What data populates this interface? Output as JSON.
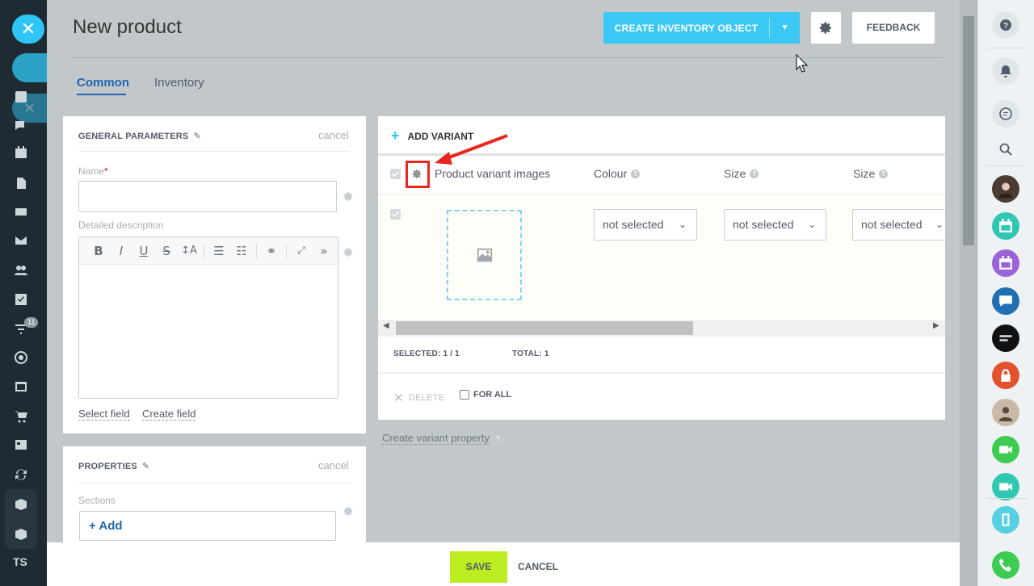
{
  "header": {
    "title": "New product",
    "create_button": "CREATE INVENTORY OBJECT",
    "feedback_button": "FEEDBACK"
  },
  "tabs": [
    {
      "label": "Common",
      "active": true
    },
    {
      "label": "Inventory",
      "active": false
    }
  ],
  "general": {
    "title": "GENERAL PARAMETERS",
    "cancel": "cancel",
    "name_label": "Name",
    "required_mark": "*",
    "name_value": "",
    "description_label": "Detailed description",
    "select_field": "Select field",
    "create_field": "Create field"
  },
  "editor_toolbar": [
    "B",
    "I",
    "U",
    "S",
    "↕A",
    "list-numbered",
    "list-bulleted",
    "link",
    "fullscreen",
    "more"
  ],
  "properties": {
    "title": "PROPERTIES",
    "cancel": "cancel",
    "sections_label": "Sections",
    "add_label": "+ Add"
  },
  "variants": {
    "add_variant": "ADD VARIANT",
    "columns": {
      "images": "Product variant images",
      "colour": "Colour",
      "size1": "Size",
      "size2": "Size"
    },
    "row": {
      "colour": "not selected",
      "size1": "not selected",
      "size2": "not selected"
    },
    "selected_label": "SELECTED:",
    "selected_value": "1 / 1",
    "total_label": "TOTAL:",
    "total_value": "1",
    "delete": "DELETE",
    "for_all": "FOR ALL",
    "create_property": "Create variant property"
  },
  "left_rail": {
    "badge": "11",
    "user_initials": "TS"
  },
  "footer": {
    "save": "SAVE",
    "cancel": "CANCEL"
  },
  "colors": {
    "accent": "#3bc8f5",
    "save": "#bbed21",
    "highlight": "#e8261f",
    "tab_active": "#2067b0"
  }
}
